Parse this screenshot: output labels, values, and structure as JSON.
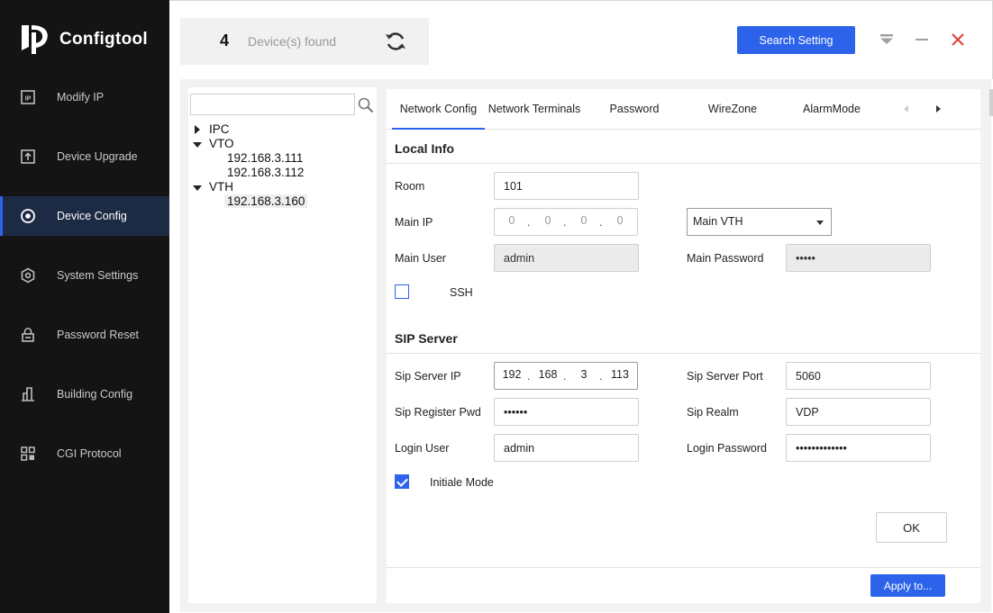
{
  "app": {
    "title": "Configtool",
    "logo_icon": "configtool-logo-icon"
  },
  "sidebar": {
    "items": [
      {
        "label": "Modify IP",
        "icon": "modify-ip-icon"
      },
      {
        "label": "Device Upgrade",
        "icon": "upload-icon"
      },
      {
        "label": "Device Config",
        "icon": "target-icon",
        "active": true
      },
      {
        "label": "System Settings",
        "icon": "hexagon-gear-icon"
      },
      {
        "label": "Password Reset",
        "icon": "lock-icon"
      },
      {
        "label": "Building Config",
        "icon": "building-icon"
      },
      {
        "label": "CGI Protocol",
        "icon": "grid-icon"
      }
    ]
  },
  "header": {
    "device_count": "4",
    "device_found_label": "Device(s) found",
    "refresh_icon": "refresh-icon",
    "search_setting_label": "Search Setting",
    "controls": [
      "dropdown-icon",
      "minimize-icon",
      "close-icon"
    ]
  },
  "tree": {
    "search_placeholder": "",
    "search_icon": "search-icon",
    "nodes": [
      {
        "label": "IPC",
        "expanded": false,
        "children": []
      },
      {
        "label": "VTO",
        "expanded": true,
        "children": [
          "192.168.3.111",
          "192.168.3.112"
        ]
      },
      {
        "label": "VTH",
        "expanded": true,
        "children": [
          "192.168.3.160"
        ],
        "selected_child": "192.168.3.160"
      }
    ]
  },
  "tabs": {
    "items": [
      {
        "label": "Network Config",
        "active": true
      },
      {
        "label": "Network Terminals"
      },
      {
        "label": "Password"
      },
      {
        "label": "WireZone"
      },
      {
        "label": "AlarmMode"
      }
    ],
    "prev_icon": "chevron-left-icon",
    "next_icon": "chevron-right-icon"
  },
  "local_info": {
    "title": "Local Info",
    "room_label": "Room",
    "room_value": "101",
    "main_ip_label": "Main IP",
    "main_ip": [
      "0",
      "0",
      "0",
      "0"
    ],
    "main_vth_select": "Main VTH",
    "main_user_label": "Main User",
    "main_user_value": "admin",
    "main_password_label": "Main Password",
    "main_password_value": "•••••",
    "ssh_label": "SSH",
    "ssh_checked": false
  },
  "sip_server": {
    "title": "SIP Server",
    "server_ip_label": "Sip Server IP",
    "server_ip": [
      "192",
      "168",
      "3",
      "113"
    ],
    "server_port_label": "Sip Server Port",
    "server_port_value": "5060",
    "register_pwd_label": "Sip Register Pwd",
    "register_pwd_value": "••••••",
    "realm_label": "Sip Realm",
    "realm_value": "VDP",
    "login_user_label": "Login User",
    "login_user_value": "admin",
    "login_password_label": "Login Password",
    "login_password_value": "•••••••••••••",
    "initiale_mode_label": "Initiale Mode",
    "initiale_mode_checked": true
  },
  "actions": {
    "ok_label": "OK",
    "apply_label": "Apply to..."
  },
  "colors": {
    "accent": "#2d63ea",
    "sidebar_bg": "#141414",
    "close": "#e0463b"
  }
}
